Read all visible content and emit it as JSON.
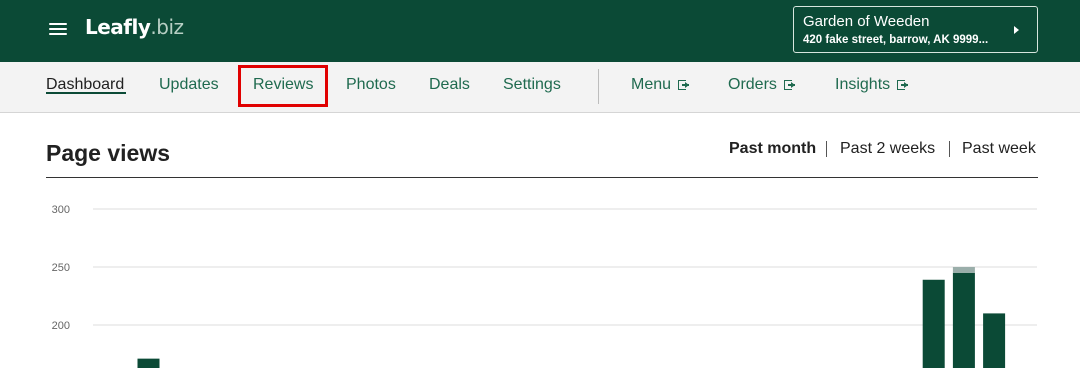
{
  "header": {
    "logo_main": "Leafly",
    "logo_suffix": ".biz",
    "store": {
      "name": "Garden of Weeden",
      "address": "420 fake street, barrow, AK 9999..."
    }
  },
  "nav": {
    "tabs": [
      {
        "id": "dashboard",
        "label": "Dashboard",
        "active": true
      },
      {
        "id": "updates",
        "label": "Updates"
      },
      {
        "id": "reviews",
        "label": "Reviews",
        "highlighted": true
      },
      {
        "id": "photos",
        "label": "Photos"
      },
      {
        "id": "deals",
        "label": "Deals"
      },
      {
        "id": "settings",
        "label": "Settings"
      }
    ],
    "external": [
      {
        "id": "menu",
        "label": "Menu"
      },
      {
        "id": "orders",
        "label": "Orders"
      },
      {
        "id": "insights",
        "label": "Insights"
      }
    ]
  },
  "main": {
    "title": "Page views",
    "ranges": [
      {
        "id": "past-month",
        "label": "Past month",
        "active": true
      },
      {
        "id": "past-2-weeks",
        "label": "Past 2 weeks"
      },
      {
        "id": "past-week",
        "label": "Past week"
      }
    ]
  },
  "colors": {
    "brand": "#0b4a36",
    "highlight": "#e00000",
    "bar_secondary": "#9aaeaa"
  },
  "chart_data": {
    "type": "bar",
    "title": "",
    "ylabel": "",
    "xlabel": "",
    "ylim": [
      185,
      300
    ],
    "yticks": [
      200,
      250,
      300
    ],
    "grid": true,
    "series": [
      {
        "values": [
          null,
          171,
          null,
          null,
          null,
          null,
          null,
          null,
          null,
          null,
          null,
          null,
          null,
          null,
          null,
          null,
          null,
          null,
          null,
          null,
          null,
          null,
          null,
          null,
          null,
          null,
          null,
          239,
          245,
          210
        ]
      },
      {
        "values": [
          null,
          0,
          null,
          null,
          null,
          null,
          null,
          null,
          null,
          null,
          null,
          null,
          null,
          null,
          null,
          null,
          null,
          null,
          null,
          null,
          null,
          null,
          null,
          null,
          null,
          null,
          null,
          0,
          5,
          0
        ]
      }
    ]
  }
}
